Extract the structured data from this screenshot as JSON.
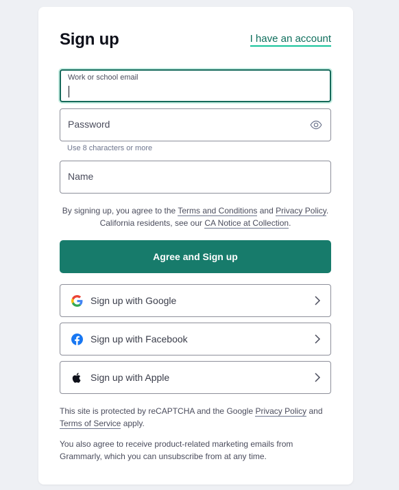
{
  "header": {
    "title": "Sign up",
    "account_link": "I have an account"
  },
  "form": {
    "email": {
      "label": "Work or school email",
      "value": ""
    },
    "password": {
      "placeholder": "Password",
      "hint": "Use 8 characters or more"
    },
    "name": {
      "placeholder": "Name"
    }
  },
  "terms": {
    "prefix": "By signing up, you agree to the ",
    "terms_link": "Terms and Conditions",
    "and": " and ",
    "privacy_link": "Privacy Policy",
    "period": ".",
    "california_prefix": "California residents, see our ",
    "ca_notice_link": "CA Notice at Collection",
    "california_suffix": "."
  },
  "primary_button": "Agree and Sign up",
  "social": [
    {
      "label": "Sign up with Google",
      "icon": "google-icon"
    },
    {
      "label": "Sign up with Facebook",
      "icon": "facebook-icon"
    },
    {
      "label": "Sign up with Apple",
      "icon": "apple-icon"
    }
  ],
  "footer": {
    "recaptcha_prefix": "This site is protected by reCAPTCHA and the Google ",
    "privacy_link": "Privacy Policy",
    "and": " and ",
    "tos_link": "Terms of Service",
    "apply": " apply.",
    "marketing": "You also agree to receive product-related marketing emails from Grammarly, which you can unsubscribe from at any time."
  },
  "colors": {
    "primary": "#177b6b",
    "link": "#0e6e5c",
    "link_underline": "#15c39a",
    "background": "#eef0f4"
  }
}
